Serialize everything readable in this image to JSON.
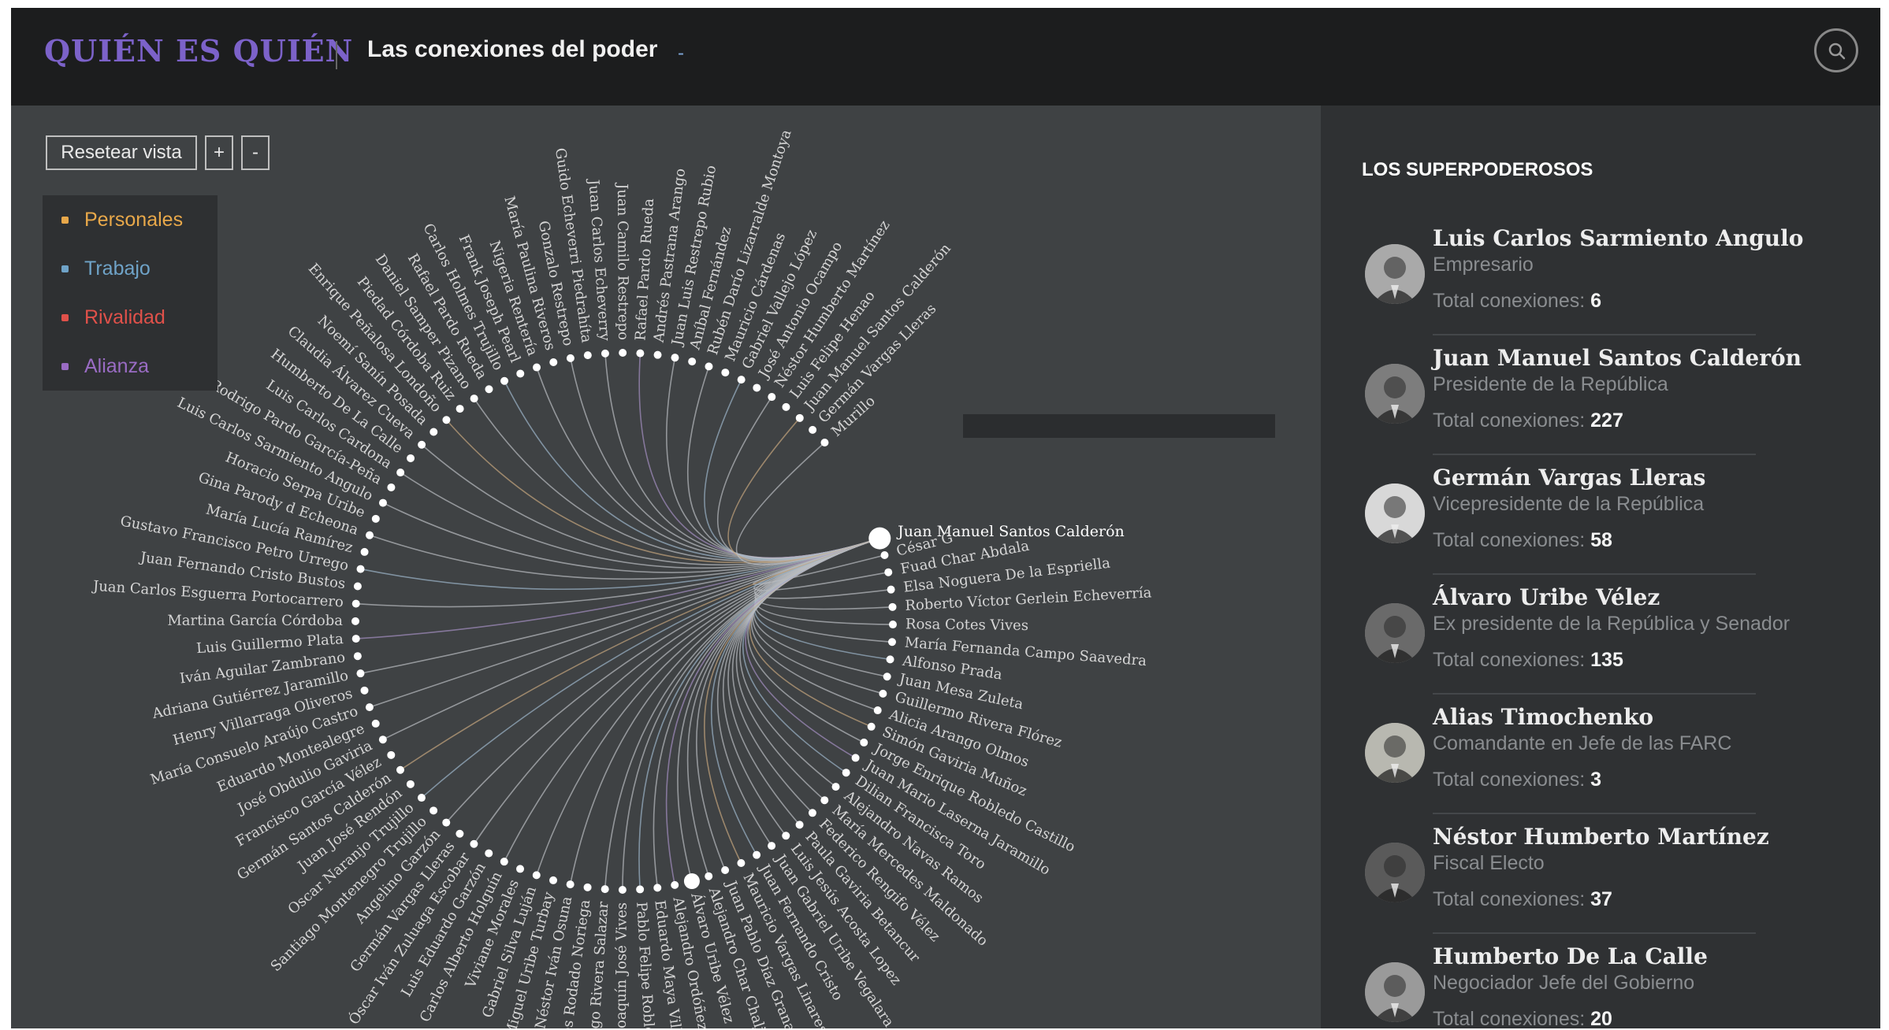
{
  "header": {
    "brand": "QUIÉN ES QUIÉN",
    "subtitle": "Las conexiones del poder",
    "subtitle_caret": "-"
  },
  "controls": {
    "reset_label": "Resetear vista",
    "zoom_in_label": "+",
    "zoom_out_label": "-"
  },
  "legend": [
    {
      "label": "Personales",
      "color": "#e8a84a"
    },
    {
      "label": "Trabajo",
      "color": "#6fa3c8"
    },
    {
      "label": "Rivalidad",
      "color": "#e0514a"
    },
    {
      "label": "Alianza",
      "color": "#9a6cc4"
    }
  ],
  "graph": {
    "highlighted": "Juan Manuel Santos Calderón",
    "nodes": [
      "Juan Manuel Santos Calderón",
      "César G",
      "Fuad Char Abdala",
      "Elsa Noguera De la Espriella",
      "Roberto Víctor Gerlein Echeverría",
      "Rosa Cotes Vives",
      "María Fernanda Campo Saavedra",
      "Alfonso Prada",
      "Juan Mesa Zuleta",
      "Guillermo Rivera Flórez",
      "Alicia Arango Olmos",
      "Simón Gaviria Muñoz",
      "Jorge Enrique Robledo Castillo",
      "Juan Mario Laserna Jaramillo",
      "Dilian Francisca Toro",
      "Alejandro Navas Ramos",
      "María Mercedes Maldonado",
      "Federico Rengifo Vélez",
      "Paula Gaviria Betancur",
      "Luis Jesús Acosta Lopez",
      "Juan Gabriel Uribe Vegalara",
      "Juan Fernando Cristo",
      "Mauricio Vargas Linares",
      "Juan Pablo Díaz Granados",
      "Alejandro Char Chaljub",
      "Álvaro Uribe Vélez",
      "Alejandro Ordóñez",
      "Eduardo Maya Villazón",
      "Pablo Felipe Robledo",
      "Joaquín José Vives",
      "Rodrigo Rivera Salazar",
      "Carlos Rodado Noriega",
      "Néstor Iván Osuna",
      "Miguel Uribe Turbay",
      "Gabriel Silva Luján",
      "Viviane Morales",
      "Carlos Alberto Holguín",
      "Luis Eduardo Garzón",
      "Óscar Iván Zuluaga Escobar",
      "Germán Vargas Lleras",
      "Angelino Garzón",
      "Santiago Montenegro Trujillo",
      "Oscar Naranjo Trujillo",
      "Juan José Rendón",
      "Germán Santos Calderón",
      "Francisco García Vélez",
      "José Obdulio Gaviria",
      "Eduardo Montealegre",
      "María Consuelo Araújo Castro",
      "Henry Villarraga Oliveros",
      "Adriana Gutiérrez Jaramillo",
      "Iván Aguilar Zambrano",
      "Luis Guillermo Plata",
      "Martina García Córdoba",
      "Juan Carlos Esguerra Portocarrero",
      "Juan Fernando Cristo Bustos",
      "Gustavo Francisco Petro Urrego",
      "María Lucía Ramírez",
      "Gina Parody d Echeona",
      "Horacio Serpa Uribe",
      "Luis Carlos Sarmiento Angulo",
      "Rodrigo Pardo García-Peña",
      "Luis Carlos Cardona",
      "Humberto De La Calle",
      "Claudia Álvarez Cueva",
      "Noemí Sanín Posada",
      "Enrique Peñalosa Londoño",
      "Piedad Córdoba Ruiz",
      "Daniel Samper Pizano",
      "Rafael Pardo Rueda",
      "Carlos Holmes Trujillo",
      "Frank Joseph Pearl",
      "Nigeria Rentería",
      "María Paulina Riveros",
      "Gonzalo Restrepo",
      "Guido Echeverri Piedrahíta",
      "Juan Carlos Echeverry",
      "Juan Camilo Restrepo",
      "Rafael Pardo Rueda",
      "Andrés Pastrana Arango",
      "Juan Luis Restrepo Rubio",
      "Aníbal Fernández",
      "Rubén Darío Lizarralde Montoya",
      "Mauricio Cárdenas",
      "Gabriel Vallejo López",
      "José Antonio Ocampo",
      "Néstor Humberto Martínez",
      "Luis Felipe Henao",
      "Juan Manuel Santos Calderón",
      "Germán Vargas Lleras",
      "Murillo"
    ]
  },
  "panel": {
    "title": "LOS SUPERPODEROSOS",
    "total_label": "Total conexiones:",
    "people": [
      {
        "name": "Luis Carlos Sarmiento Angulo",
        "role": "Empresario",
        "total": "6"
      },
      {
        "name": "Juan Manuel Santos Calderón",
        "role": "Presidente de la República",
        "total": "227"
      },
      {
        "name": "Germán Vargas Lleras",
        "role": "Vicepresidente de la República",
        "total": "58"
      },
      {
        "name": "Álvaro Uribe Vélez",
        "role": "Ex presidente de la República y Senador",
        "total": "135"
      },
      {
        "name": "Alias Timochenko",
        "role": "Comandante en Jefe de las FARC",
        "total": "3"
      },
      {
        "name": "Néstor Humberto Martínez",
        "role": "Fiscal Electo",
        "total": "37"
      },
      {
        "name": "Humberto De La Calle",
        "role": "Negociador Jefe del Gobierno",
        "total": "20"
      }
    ]
  }
}
